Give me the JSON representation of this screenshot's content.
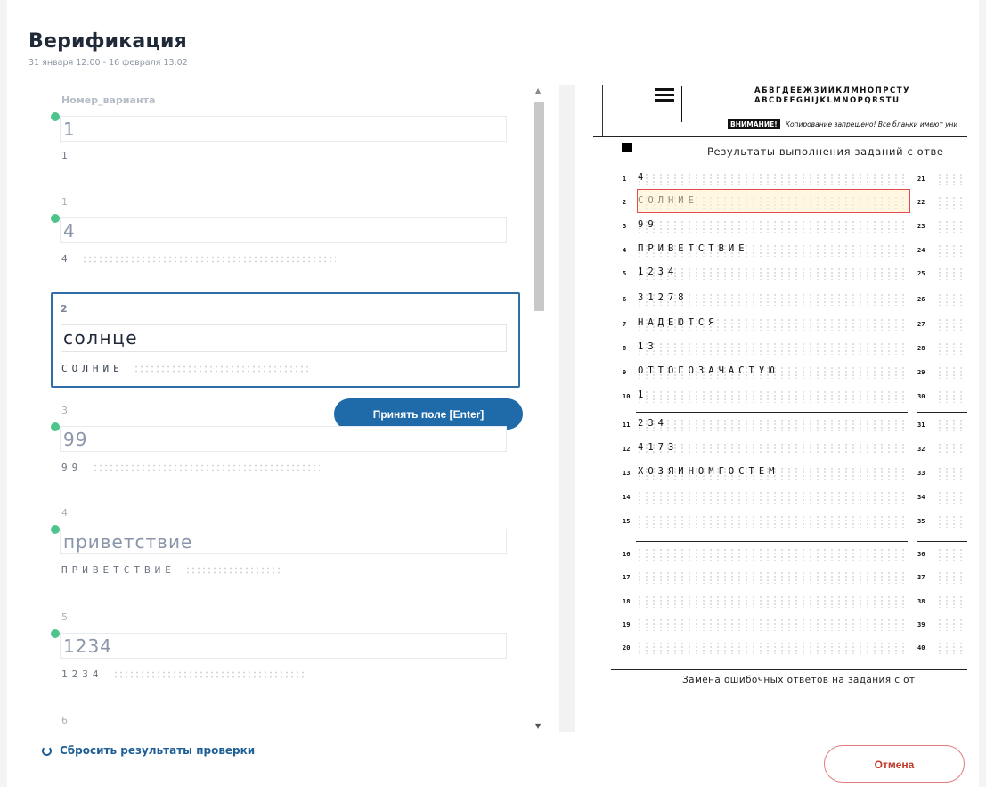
{
  "header": {
    "title": "Верификация",
    "dates": "31 января 12:00 - 16 февраля 13:02"
  },
  "fields": [
    {
      "label": "Номер_варианта",
      "value": "1",
      "handwriting": "1"
    },
    {
      "label": "1",
      "value": "4",
      "handwriting": "4"
    },
    {
      "label": "2",
      "value": "солнце",
      "handwriting": "СОЛНИЕ"
    },
    {
      "label": "3",
      "value": "99",
      "handwriting": "99"
    },
    {
      "label": "4",
      "value": "приветствие",
      "handwriting": "ПРИВЕТСТВИЕ"
    },
    {
      "label": "5",
      "value": "1234",
      "handwriting": "1234"
    },
    {
      "label": "6",
      "value": "",
      "handwriting": ""
    }
  ],
  "accept_button": "Принять поле [Enter]",
  "reset_link": "Сбросить результаты проверки",
  "cancel_button": "Отмена",
  "form": {
    "alphabet_line1": "АБВГДЕЁЖЗИЙКЛМНОПРСТУ",
    "alphabet_line2": "ABCDEFGHIJKLMNOPQRSTU",
    "warning_label": "ВНИМАНИЕ!",
    "warning_text": "Копирование запрещено! Все бланки имеют уни",
    "title": "Результаты выполнения заданий с отве",
    "footer": "Замена ошибочных ответов на задания с от",
    "rows": [
      {
        "n": "1",
        "text": "4"
      },
      {
        "n": "2",
        "text": "СОЛНИЕ"
      },
      {
        "n": "3",
        "text": "99"
      },
      {
        "n": "4",
        "text": "ПРИВЕТСТВИЕ"
      },
      {
        "n": "5",
        "text": "1234"
      },
      {
        "n": "6",
        "text": "31278"
      },
      {
        "n": "7",
        "text": "НАДЕЮТСЯ"
      },
      {
        "n": "8",
        "text": "13"
      },
      {
        "n": "9",
        "text": "ОТТОГОЗАЧАСТУЮ"
      },
      {
        "n": "10",
        "text": "1"
      },
      {
        "n": "11",
        "text": "234"
      },
      {
        "n": "12",
        "text": "4173"
      },
      {
        "n": "13",
        "text": "ХОЗЯИНОМГОСТЕМ"
      },
      {
        "n": "14",
        "text": ""
      },
      {
        "n": "15",
        "text": ""
      },
      {
        "n": "16",
        "text": ""
      },
      {
        "n": "17",
        "text": ""
      },
      {
        "n": "18",
        "text": ""
      },
      {
        "n": "19",
        "text": ""
      },
      {
        "n": "20",
        "text": ""
      }
    ],
    "right_numbers": [
      "21",
      "22",
      "23",
      "24",
      "25",
      "26",
      "27",
      "28",
      "29",
      "30",
      "31",
      "32",
      "33",
      "34",
      "35",
      "36",
      "37",
      "38",
      "39",
      "40"
    ]
  }
}
